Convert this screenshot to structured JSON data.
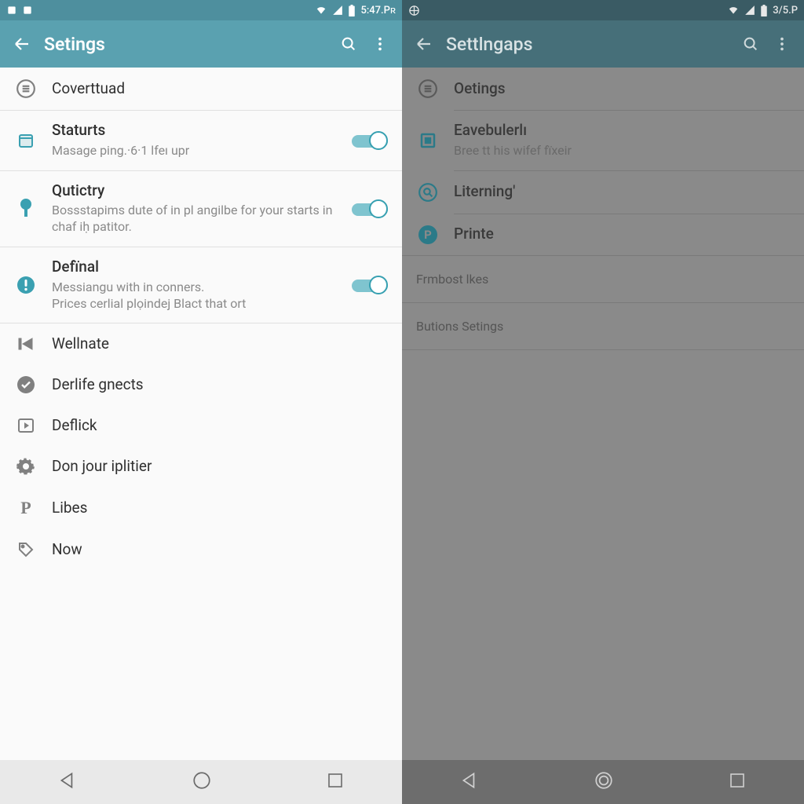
{
  "left": {
    "status": {
      "time": "5:47.Pʀ"
    },
    "appbar": {
      "title": "Setings"
    },
    "items": [
      {
        "title": "Coverttuad",
        "desc": "",
        "toggle": false,
        "icon": "list-circle"
      },
      {
        "title": "Staturts",
        "desc": "Masage ping.·6·1 lfeı upr",
        "toggle": true,
        "icon": "calendar"
      },
      {
        "title": "Qutictry",
        "desc": "Bossstapims dute of in pl angilbe for your starts in chaf iḥ patitor.",
        "toggle": true,
        "icon": "pin"
      },
      {
        "title": "Defïnal",
        "desc": "Messiangu with in conners.\nPrices cerlial plọindej Blact that ort",
        "toggle": true,
        "icon": "alert-circle"
      },
      {
        "title": "Wellnate",
        "desc": "",
        "toggle": false,
        "icon": "skip-back"
      },
      {
        "title": "Derlife gnects",
        "desc": "",
        "toggle": false,
        "icon": "check-circle"
      },
      {
        "title": "Deflick",
        "desc": "",
        "toggle": false,
        "icon": "play-box"
      },
      {
        "title": "Don jour iplitier",
        "desc": "",
        "toggle": false,
        "icon": "gear"
      },
      {
        "title": "Libes",
        "desc": "",
        "toggle": false,
        "icon": "letter-p"
      },
      {
        "title": "Now",
        "desc": "",
        "toggle": false,
        "icon": "tag"
      }
    ]
  },
  "right": {
    "status": {
      "time": "3/5.P"
    },
    "appbar": {
      "title": "Settlngaps"
    },
    "items": [
      {
        "title": "Oetings",
        "desc": "",
        "icon": "list-circle"
      },
      {
        "title": "Eavebulerlı",
        "desc": "Bree tt his wifef fïxeir",
        "icon": "square"
      },
      {
        "title": "Literning'",
        "desc": "",
        "icon": "search-circle"
      },
      {
        "title": "Printe",
        "desc": "",
        "icon": "letter-p-filled"
      }
    ],
    "sections": [
      "Frmbost lkes",
      "Butions Setings"
    ]
  }
}
